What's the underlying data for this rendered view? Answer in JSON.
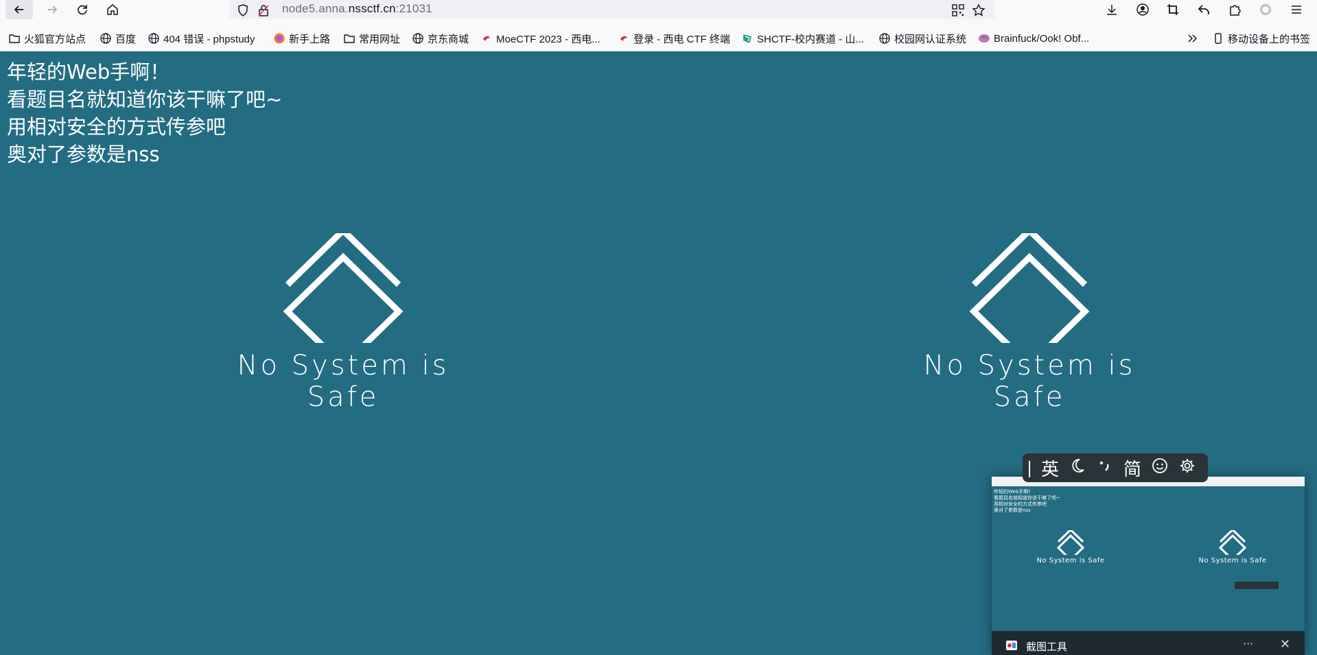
{
  "browser": {
    "url_host_prefix": "node5.anna.",
    "url_host_main": "nssctf.cn",
    "url_port": ":21031"
  },
  "bookmarks": [
    {
      "label": "火狐官方站点",
      "icon": "folder-icon"
    },
    {
      "label": "百度",
      "icon": "globe-icon"
    },
    {
      "label": "404 错误 - phpstudy",
      "icon": "globe-icon"
    },
    {
      "label": "新手上路",
      "icon": "firefox-icon"
    },
    {
      "label": "常用网址",
      "icon": "folder-icon"
    },
    {
      "label": "京东商城",
      "icon": "globe-icon"
    },
    {
      "label": "MoeCTF 2023 - 西电...",
      "icon": "xdsec-icon"
    },
    {
      "label": "登录 - 西电 CTF 终端",
      "icon": "xdsec-icon"
    },
    {
      "label": "SHCTF-校内赛道 - 山...",
      "icon": "shctf-icon"
    },
    {
      "label": "校园网认证系统",
      "icon": "globe-icon"
    },
    {
      "label": "Brainfuck/Ook! Obf...",
      "icon": "brain-icon"
    }
  ],
  "mobile_bookmarks": "移动设备上的书签",
  "page": {
    "lines": [
      "年轻的Web手啊！",
      "看题目名就知道你该干嘛了吧~",
      "用相对安全的方式传参吧",
      "奥对了参数是nss"
    ],
    "slogan": "No System is Safe"
  },
  "ime": {
    "lang": "英",
    "mode": "简"
  },
  "snip": {
    "title": "截图工具",
    "more": "···",
    "close": "✕"
  }
}
